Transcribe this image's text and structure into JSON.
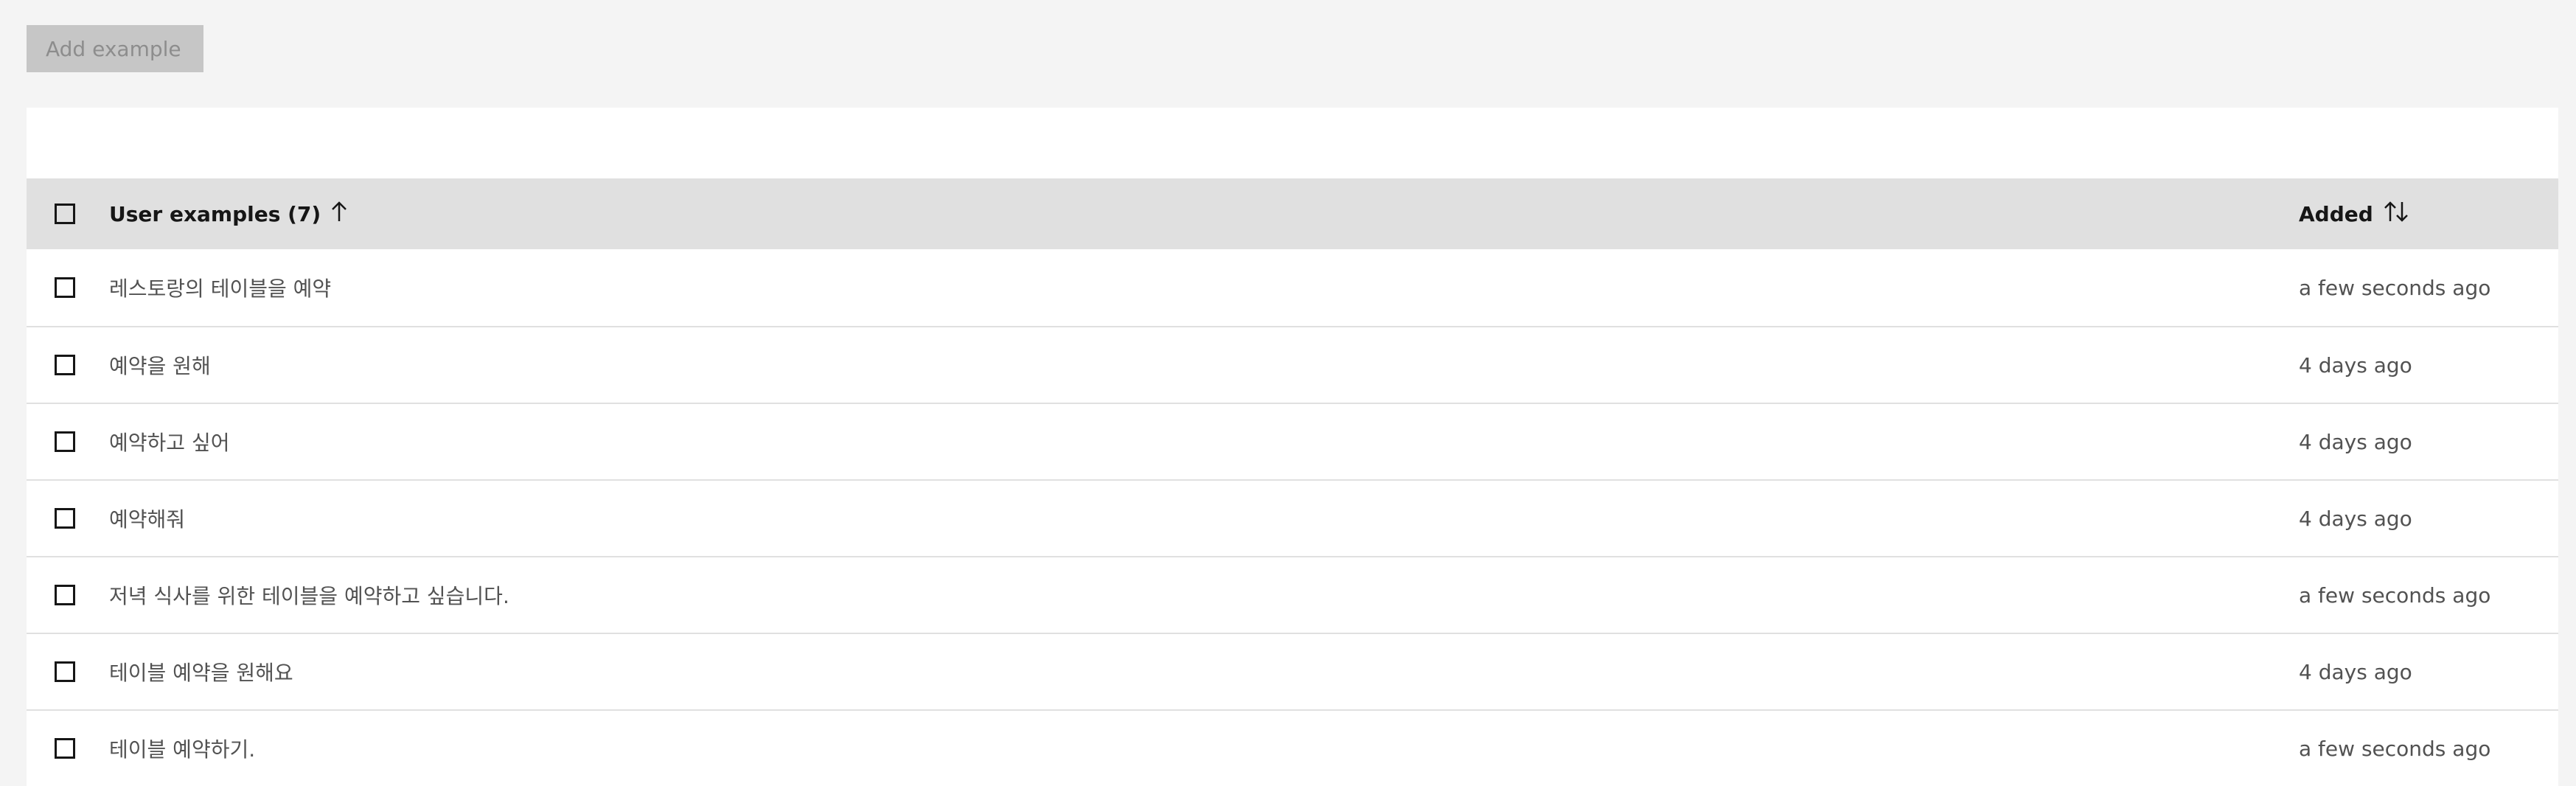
{
  "toolbar": {
    "add_label": "Add example"
  },
  "table": {
    "header": {
      "example_label": "User examples (7)",
      "added_label": "Added"
    },
    "rows": [
      {
        "example": "레스토랑의 테이블을 예약",
        "added": "a few seconds ago"
      },
      {
        "example": "예약을 원해",
        "added": "4 days ago"
      },
      {
        "example": "예약하고 싶어",
        "added": "4 days ago"
      },
      {
        "example": "예약해줘",
        "added": "4 days ago"
      },
      {
        "example": "저녁 식사를 위한 테이블을 예약하고 싶습니다.",
        "added": "a few seconds ago"
      },
      {
        "example": "테이블 예약을 원해요",
        "added": "4 days ago"
      },
      {
        "example": "테이블 예약하기.",
        "added": "a few seconds ago"
      }
    ]
  },
  "icons": {
    "sort_ascending": "arrow-up-icon",
    "sort_both": "arrows-vertical-icon"
  },
  "colors": {
    "background": "#f4f4f4",
    "header_bg": "#e0e0e0",
    "disabled_button": "#c6c6c6"
  }
}
